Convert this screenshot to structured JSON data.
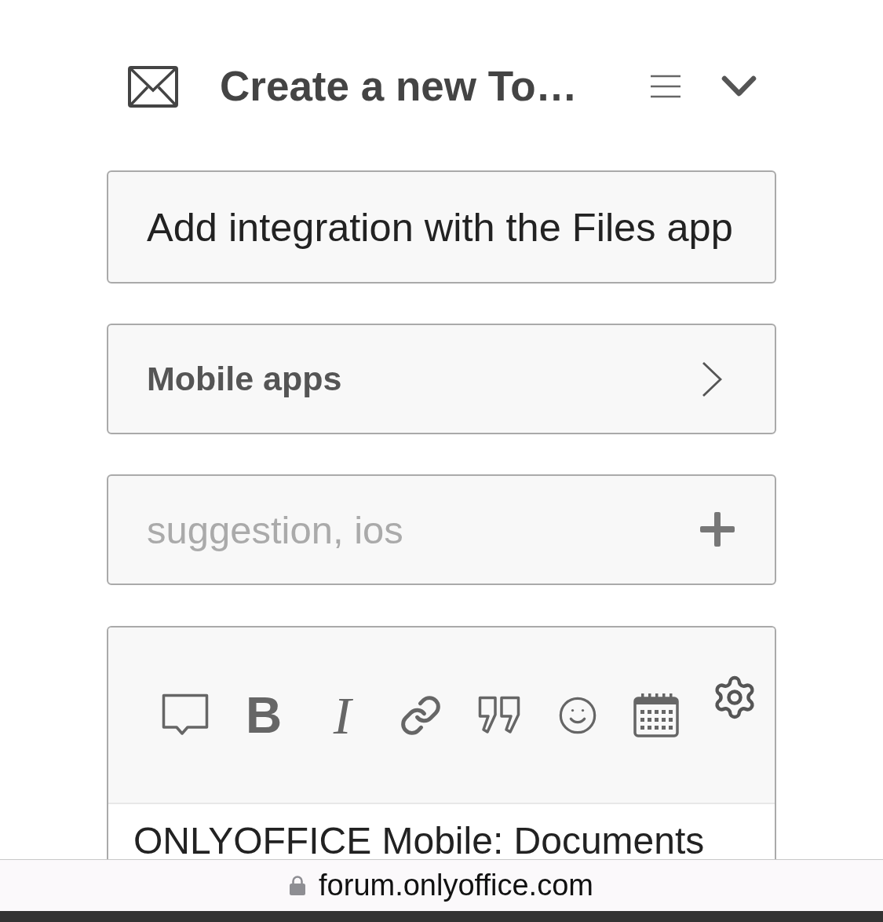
{
  "header": {
    "title": "Create a new To…"
  },
  "title_field": {
    "value": "Add integration with the Files app"
  },
  "category": {
    "label": "Mobile apps"
  },
  "tags_field": {
    "placeholder": "suggestion, ios"
  },
  "editor": {
    "toolbar": {
      "bold_label": "B",
      "italic_label": "I"
    },
    "text": "ONLYOFFICE Mobile: Documents"
  },
  "browser_bar": {
    "url": "forum.onlyoffice.com"
  }
}
